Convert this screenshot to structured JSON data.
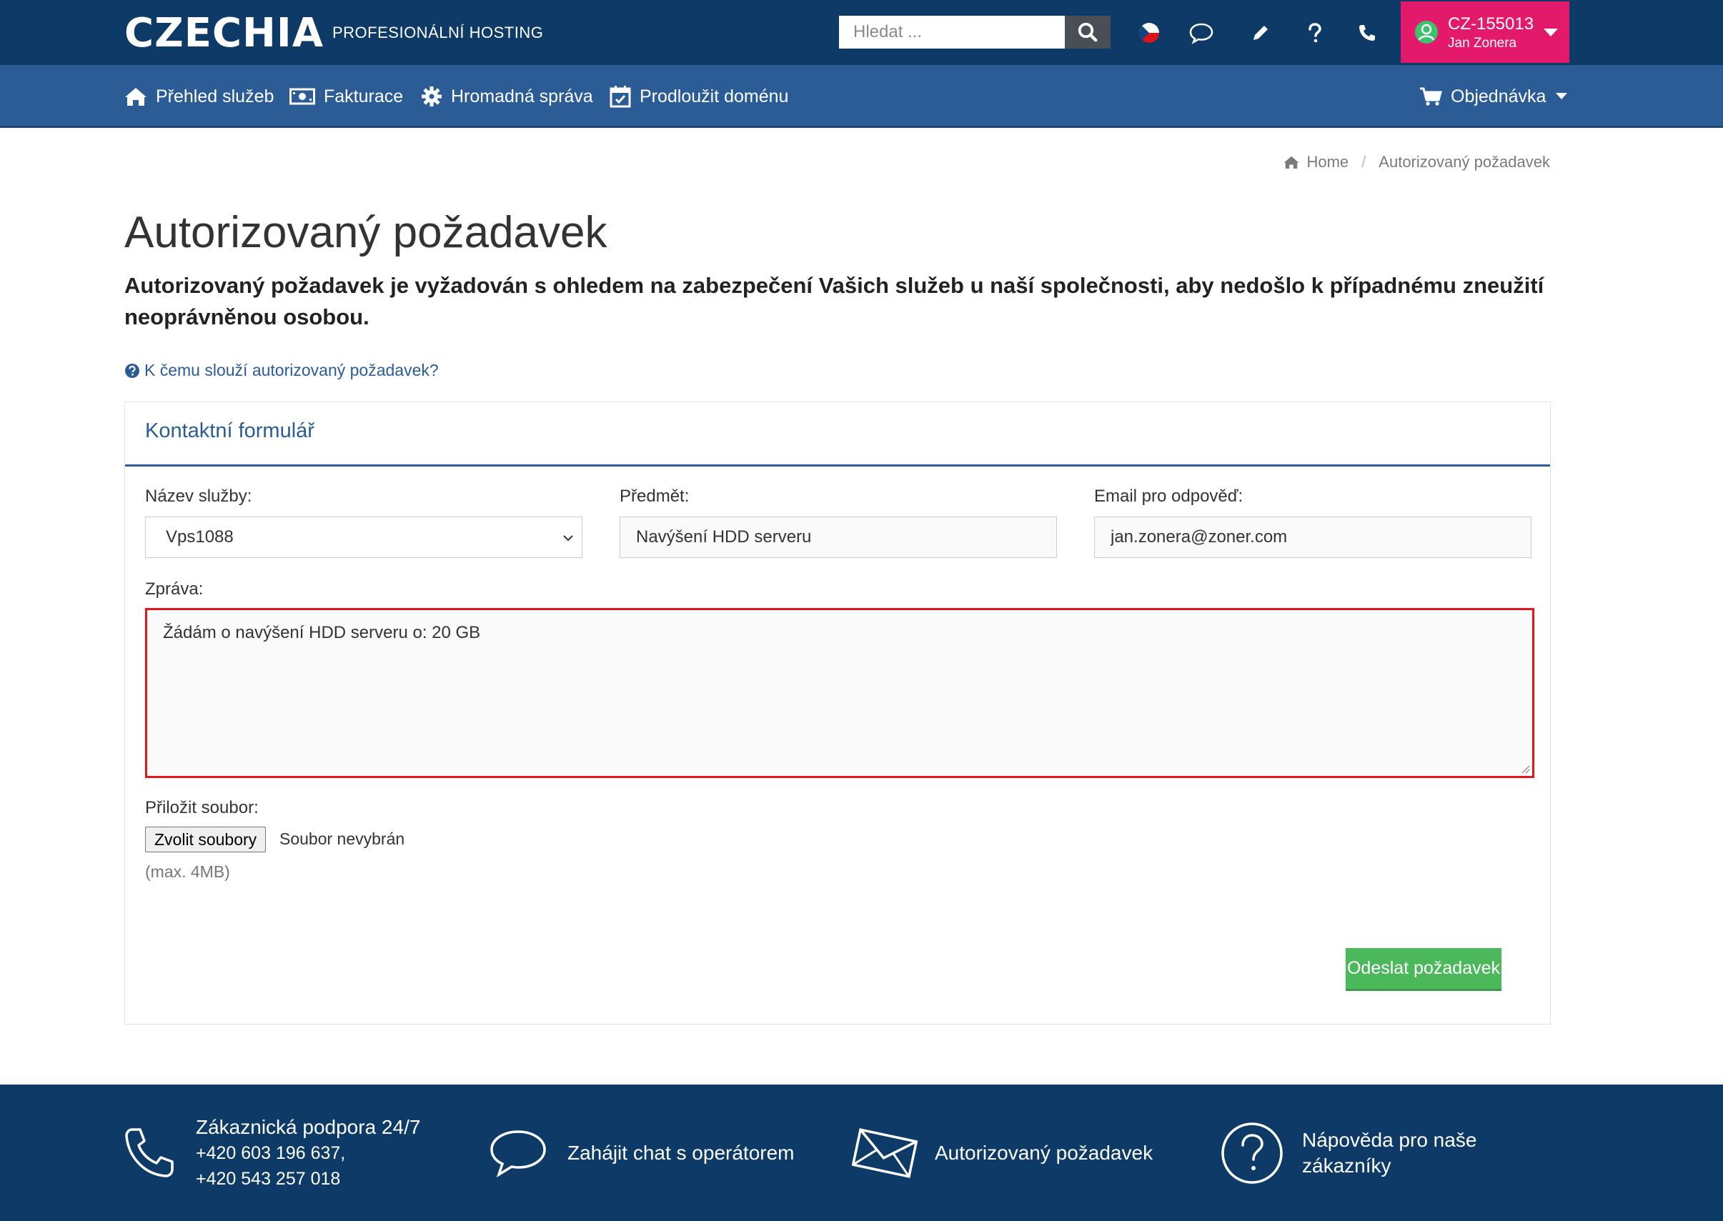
{
  "header": {
    "logo": "CZECHIA",
    "tagline": "PROFESIONÁLNÍ HOSTING",
    "search_placeholder": "Hledat ...",
    "account_id": "CZ-155013",
    "account_name": "Jan Zonera"
  },
  "nav": {
    "items": [
      {
        "label": "Přehled služeb",
        "icon": "home-icon"
      },
      {
        "label": "Fakturace",
        "icon": "money-icon"
      },
      {
        "label": "Hromadná správa",
        "icon": "gear-icon"
      },
      {
        "label": "Prodloužit doménu",
        "icon": "calendar-check-icon"
      }
    ],
    "order_label": "Objednávka"
  },
  "breadcrumb": {
    "home": "Home",
    "separator": "/",
    "current": "Autorizovaný požadavek"
  },
  "page": {
    "title": "Autorizovaný požadavek",
    "lead": "Autorizovaný požadavek je vyžadován s ohledem na zabezpečení Vašich služeb u naší společnosti, aby nedošlo k případnému zneužití neoprávněnou osobou.",
    "help_link": "K čemu slouží autorizovaný požadavek?"
  },
  "form": {
    "title": "Kontaktní formulář",
    "service_label": "Název služby:",
    "service_value": "Vps1088",
    "subject_label": "Předmět:",
    "subject_value": "Navýšení HDD serveru",
    "email_label": "Email pro odpověď:",
    "email_value": "jan.zonera@zoner.com",
    "message_label": "Zpráva:",
    "message_value": "Žádám o navýšení HDD serveru o: 20 GB",
    "attach_label": "Přiložit soubor:",
    "file_button": "Zvolit soubory",
    "file_status": "Soubor nevybrán",
    "file_hint": "(max. 4MB)",
    "submit_label": "Odeslat požadavek"
  },
  "footer": {
    "support_title": "Zákaznická podpora 24/7",
    "support_phone1": "+420 603 196 637,",
    "support_phone2": "+420 543 257 018",
    "chat_label": "Zahájit chat s operátorem",
    "auth_label": "Autorizovaný požadavek",
    "help_label_line1": "Nápověda pro naše",
    "help_label_line2": "zákazníky"
  },
  "colors": {
    "topbar": "#0d3a66",
    "navbar": "#2b5c96",
    "account": "#e3196b",
    "submit": "#4cb85c",
    "highlight": "#e2151d"
  }
}
